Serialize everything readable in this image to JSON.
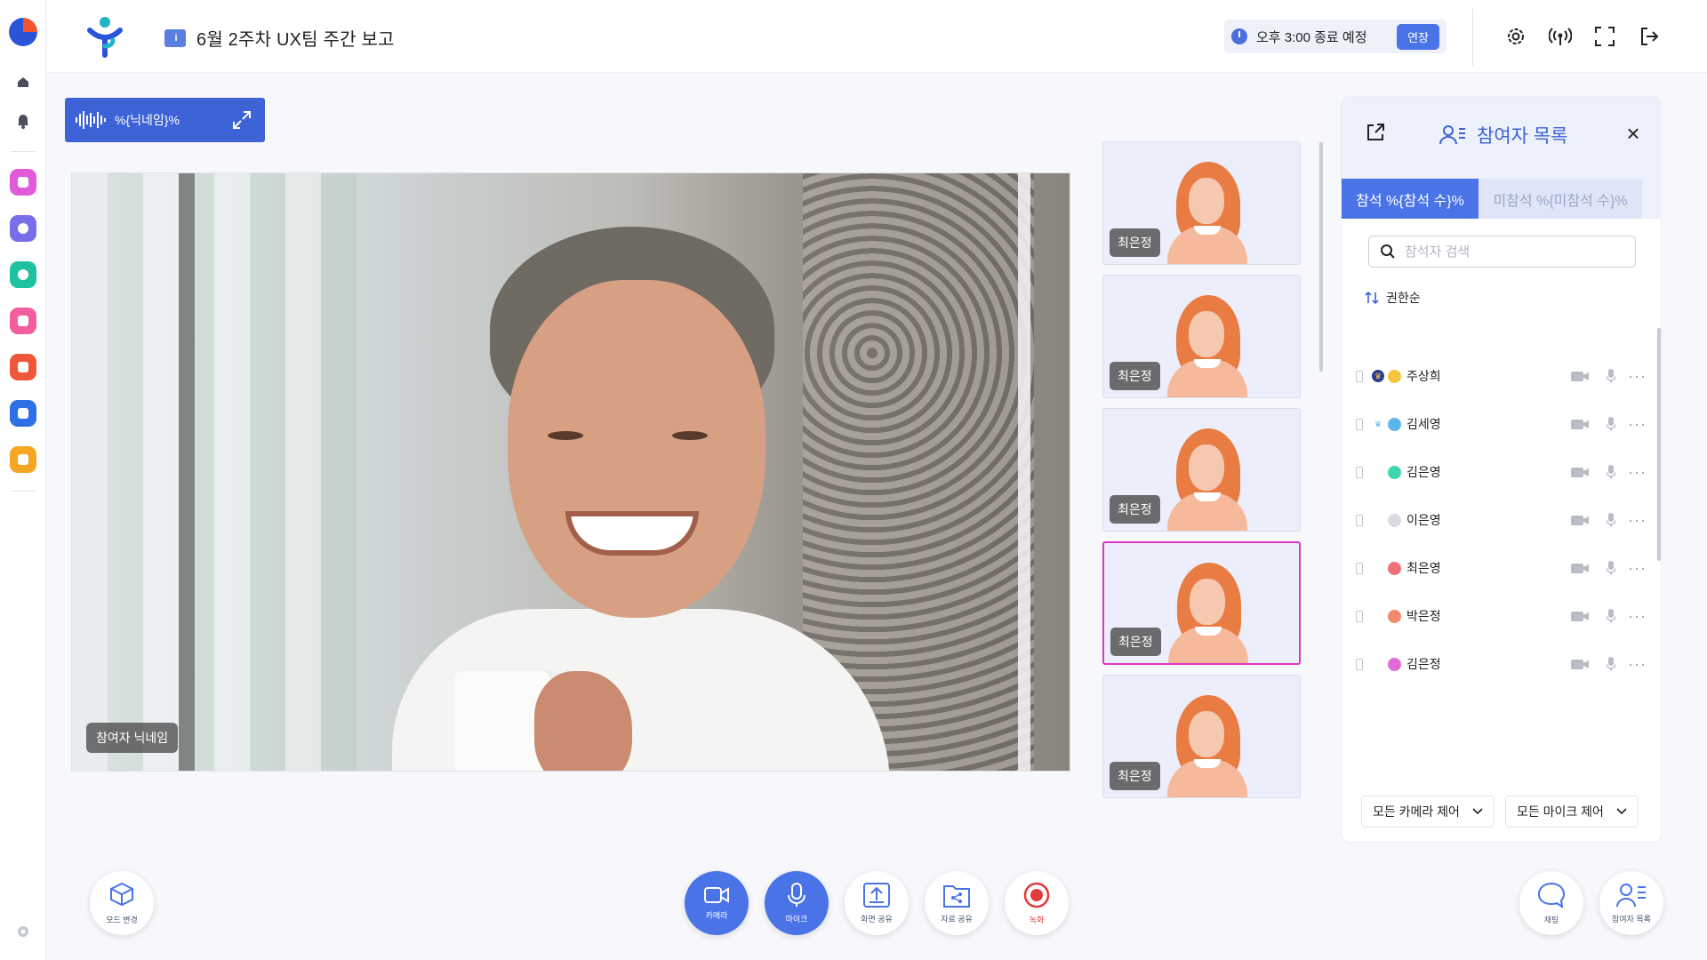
{
  "header": {
    "title": "6월 2주차 UX팀 주간 보고",
    "timer_text": "오후 3:00 종료 예정",
    "extend_label": "연장"
  },
  "speaker": {
    "name": "%{닉네임}%"
  },
  "main_video": {
    "label": "참여자 닉네임"
  },
  "thumbnails": [
    {
      "name": "최은정"
    },
    {
      "name": "최은정"
    },
    {
      "name": "최은정"
    },
    {
      "name": "최은정",
      "active": true
    },
    {
      "name": "최은정"
    }
  ],
  "panel": {
    "title": "참여자 목록",
    "tab_attend": "참석 %{참석 수}%",
    "tab_absent": "미참석 %{미참석 수}%",
    "search_placeholder": "참석자 검색",
    "sort_label": "권한순",
    "participants": [
      {
        "name": "주상희",
        "role": "host",
        "emoji_color": "#f5c542"
      },
      {
        "name": "김세영",
        "role": "cohost",
        "emoji_color": "#5bb6f0"
      },
      {
        "name": "김은영",
        "role": "",
        "emoji_color": "#3dd6b0"
      },
      {
        "name": "이은영",
        "role": "",
        "emoji_color": "#d8dbe2"
      },
      {
        "name": "최은영",
        "role": "",
        "emoji_color": "#f0707a"
      },
      {
        "name": "박은정",
        "role": "",
        "emoji_color": "#f08a6a"
      },
      {
        "name": "김은정",
        "role": "",
        "emoji_color": "#e06ad8"
      }
    ],
    "camera_control": "모든 카메라 제어",
    "mic_control": "모든 마이크 제어"
  },
  "toolbar": {
    "mode_change": "모드 변경",
    "camera": "카메라",
    "mic": "마이크",
    "screen_share": "화면 공유",
    "file_share": "자료 공유",
    "record": "녹화",
    "chat": "채팅",
    "participants": "참여자 목록"
  },
  "colors": {
    "accent": "#4a73e8",
    "active_border": "#d93ac6",
    "record": "#e23b3b"
  }
}
